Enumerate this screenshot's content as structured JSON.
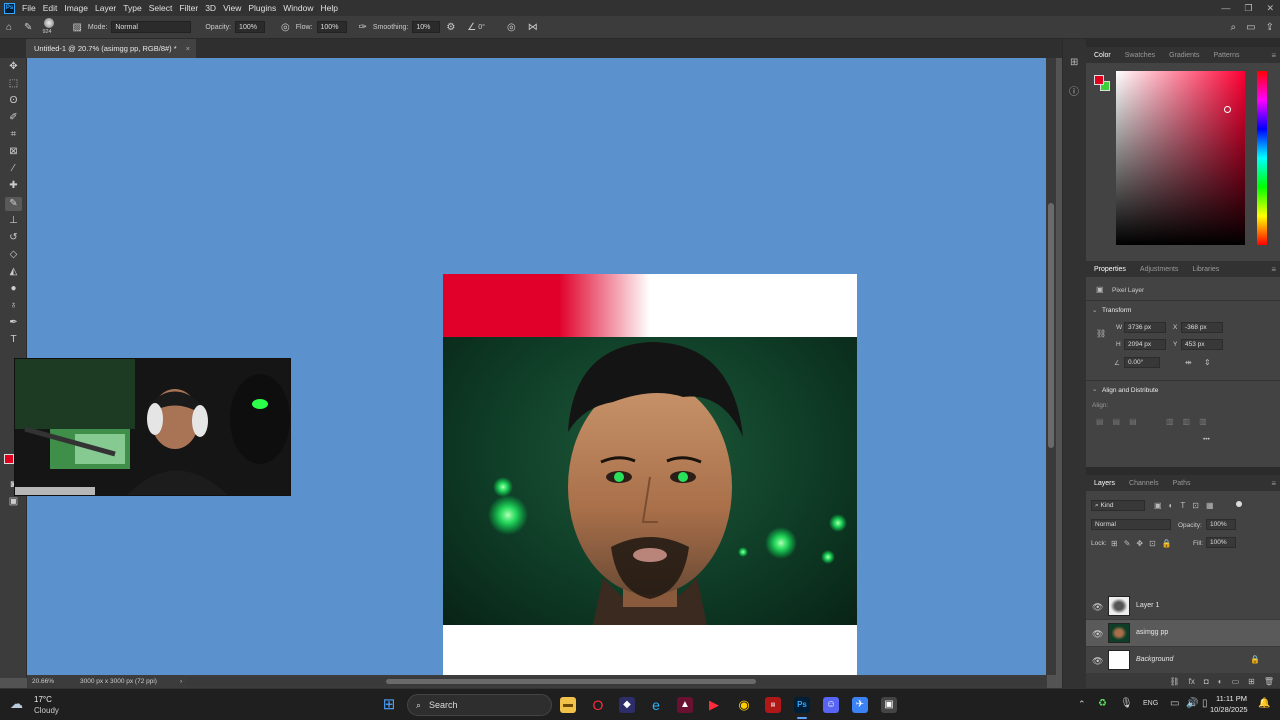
{
  "app": {
    "logo": "Ps"
  },
  "menubar": {
    "items": [
      "File",
      "Edit",
      "Image",
      "Layer",
      "Type",
      "Select",
      "Filter",
      "3D",
      "View",
      "Plugins",
      "Window",
      "Help"
    ]
  },
  "window_controls": {
    "minimize": "—",
    "restore": "❐",
    "close": "✕"
  },
  "options": {
    "brush_size": "924",
    "mode_label": "Mode:",
    "mode_value": "Normal",
    "opacity_label": "Opacity:",
    "opacity_value": "100%",
    "flow_label": "Flow:",
    "flow_value": "100%",
    "smoothing_label": "Smoothing:",
    "smoothing_value": "10%",
    "angle_value": "0°"
  },
  "document_tab": {
    "title": "Untitled-1 @ 20.7% (asimgg pp, RGB/8#) *",
    "close": "×"
  },
  "status": {
    "zoom": "20.66%",
    "doc_info": "3000 px x 3000 px (72 ppi)",
    "arrow": "›"
  },
  "color_panel": {
    "tabs": [
      "Color",
      "Swatches",
      "Gradients",
      "Patterns"
    ],
    "active_tab": "Color",
    "foreground": "#e0001f",
    "background": "#3ad13a",
    "hue": "#ff0033"
  },
  "properties_panel": {
    "tabs": [
      "Properties",
      "Adjustments",
      "Libraries"
    ],
    "active_tab": "Properties",
    "layer_type": "Pixel Layer",
    "transform_title": "Transform",
    "w_label": "W",
    "w_value": "3736 px",
    "h_label": "H",
    "h_value": "2094 px",
    "x_label": "X",
    "x_value": "-368 px",
    "y_label": "Y",
    "y_value": "453 px",
    "angle_value": "0.00°",
    "align_title": "Align and Distribute",
    "align_label": "Align:",
    "more": "•••"
  },
  "layers_panel": {
    "tabs": [
      "Layers",
      "Channels",
      "Paths"
    ],
    "active_tab": "Layers",
    "filter_kind": "Kind",
    "blend_mode": "Normal",
    "opacity_label": "Opacity:",
    "opacity_value": "100%",
    "lock_label": "Lock:",
    "fill_label": "Fill:",
    "fill_value": "100%",
    "layers": [
      {
        "name": "Layer 1",
        "selected": false,
        "locked": false
      },
      {
        "name": "asimgg pp",
        "selected": true,
        "locked": false
      },
      {
        "name": "Background",
        "selected": false,
        "locked": true
      }
    ]
  },
  "taskbar": {
    "weather_temp": "17°C",
    "weather_desc": "Cloudy",
    "search_placeholder": "Search",
    "language": "ENG",
    "time": "11:11 PM",
    "date": "10/28/2025"
  }
}
